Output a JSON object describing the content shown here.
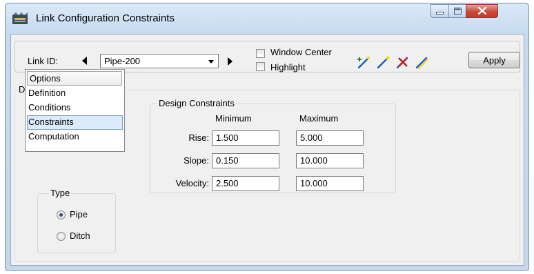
{
  "window": {
    "title": "Link Configuration Constraints",
    "icons": {
      "app": "pipe-app-icon",
      "minimize": "minimize-icon",
      "maximize": "maximize-icon",
      "close": "close-icon"
    }
  },
  "toolbar": {
    "link_id_label": "Link ID:",
    "link_id_value": "Pipe-200",
    "window_center_label": "Window Center",
    "highlight_label": "Highlight",
    "window_center_checked": false,
    "highlight_checked": false,
    "tools": [
      "add-link-icon",
      "edit-link-icon",
      "delete-link-icon",
      "connect-link-icon"
    ],
    "apply_label": "Apply"
  },
  "details": {
    "title": "Details",
    "options_header": "Options",
    "options": [
      "Definition",
      "Conditions",
      "Constraints",
      "Computation"
    ],
    "selected_option": "Constraints"
  },
  "type": {
    "title": "Type",
    "options": [
      "Pipe",
      "Ditch"
    ],
    "selected": "Pipe"
  },
  "constraints": {
    "title": "Design Constraints",
    "min_header": "Minimum",
    "max_header": "Maximum",
    "rows": [
      {
        "label": "Rise:",
        "min": "1.500",
        "max": "5.000"
      },
      {
        "label": "Slope:",
        "min": "0.150",
        "max": "10.000"
      },
      {
        "label": "Velocity:",
        "min": "2.500",
        "max": "10.000"
      }
    ]
  },
  "colors": {
    "accent_blue": "#1e5fb4",
    "delete_red": "#c0171d",
    "tool_yellow": "#f2d21a",
    "selection": "#dcebfc"
  }
}
